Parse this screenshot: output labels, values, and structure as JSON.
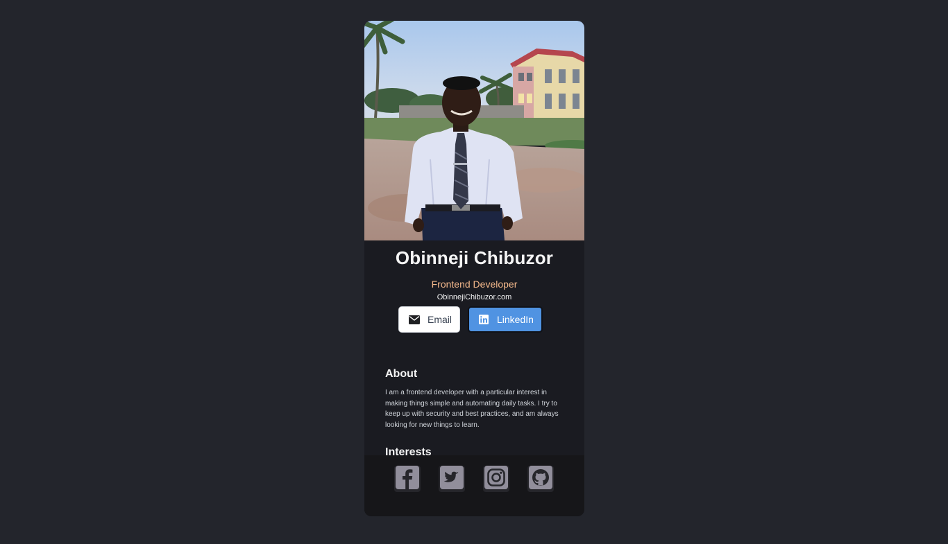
{
  "profile": {
    "name": "Obinneji Chibuzor",
    "role": "Frontend Developer",
    "website": "ObinnejiChibuzor.com"
  },
  "buttons": {
    "email_label": "Email",
    "email_icon": "envelope-icon",
    "linkedin_label": "LinkedIn",
    "linkedin_icon": "linkedin-icon"
  },
  "about": {
    "title": "About",
    "body": "I am a frontend developer with a particular interest in making things simple and automating daily tasks. I try to keep up with security and best practices, and am always looking for new things to learn."
  },
  "interests": {
    "title": "Interests"
  },
  "social": [
    {
      "icon": "facebook-icon"
    },
    {
      "icon": "twitter-icon"
    },
    {
      "icon": "instagram-icon"
    },
    {
      "icon": "github-icon"
    }
  ],
  "colors": {
    "page_background": "#23252c",
    "card_background": "#1a1b21",
    "footer_background": "#161619",
    "accent_role": "#f3b88b",
    "linkedin_blue": "#5093e2",
    "icon_gray": "#918e9b"
  }
}
